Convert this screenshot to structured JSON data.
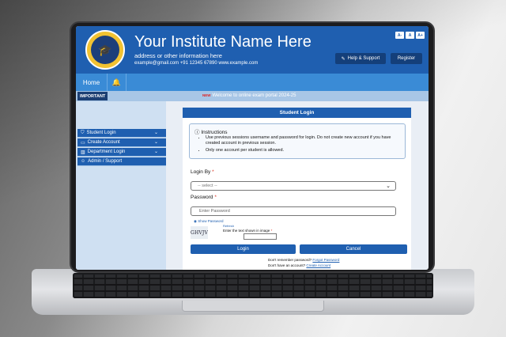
{
  "header": {
    "institute_name": "Your Institute Name Here",
    "address": "address or other information here",
    "contact": "example@gmail.com  +91 12345 67890  www.example.com",
    "logo_text": "UNIVERSITY LOGO DESIGN",
    "font_sizes": [
      "A-",
      "A",
      "A+"
    ],
    "help_label": "Help & Support",
    "register_label": "Register"
  },
  "nav": {
    "home": "Home"
  },
  "ticker": {
    "label": "IMPORTANT",
    "new_badge": "NEW",
    "message": "Welcome to online exam portal 2024-25"
  },
  "sidebar": {
    "items": [
      {
        "label": "Student Login",
        "icon": "shield-icon",
        "expandable": true
      },
      {
        "label": "Create Account",
        "icon": "id-card-icon",
        "expandable": true
      },
      {
        "label": "Department Login",
        "icon": "building-icon",
        "expandable": true
      },
      {
        "label": "Admin / Support",
        "icon": "user-icon",
        "expandable": false
      }
    ]
  },
  "login_card": {
    "title": "Student Login",
    "instructions_title": "Instructions",
    "instructions": [
      "Use previous sessions username and password for login. Do not create new account if you have created account in previous session.",
      "Only one account per student is allowed."
    ],
    "login_by_label": "Login By",
    "login_by_value": "-- select --",
    "password_label": "Password",
    "password_placeholder": "Enter Password",
    "show_password": "Show Password",
    "captcha_text": "GHVJV",
    "refresh_label": "Refresh",
    "captcha_label": "Enter the text shown in image",
    "login_button": "Login",
    "cancel_button": "Cancel",
    "forgot_text": "Don't remember password?",
    "forgot_link": "Forgot Password",
    "no_account_text": "Don't have an account?",
    "create_link": "Create Account"
  },
  "colors": {
    "primary": "#1f5fb0",
    "nav": "#3a8bd6",
    "ticker": "#a8c6e6",
    "sidebar_bg": "#cfe0f2"
  }
}
